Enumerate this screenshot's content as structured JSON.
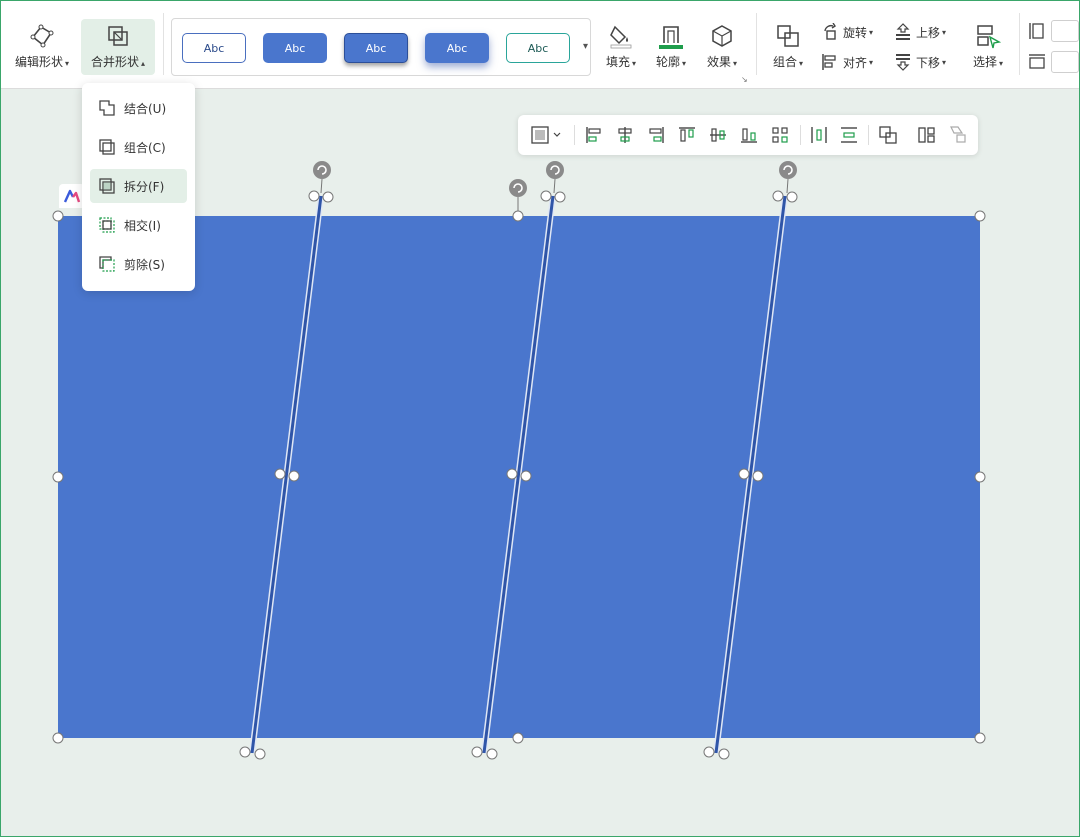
{
  "ribbon": {
    "edit_shape": "编辑形状",
    "merge_shape": "合并形状",
    "style_label": "Abc",
    "fill": "填充",
    "outline": "轮廓",
    "effect": "效果",
    "group": "组合",
    "rotate": "旋转",
    "align": "对齐",
    "bring_forward": "上移",
    "send_backward": "下移",
    "select": "选择"
  },
  "merge_menu": {
    "items": [
      {
        "label": "结合(U)",
        "icon": "union-icon"
      },
      {
        "label": "组合(C)",
        "icon": "combine-icon"
      },
      {
        "label": "拆分(F)",
        "icon": "fragment-icon"
      },
      {
        "label": "相交(I)",
        "icon": "intersect-icon"
      },
      {
        "label": "剪除(S)",
        "icon": "subtract-icon"
      }
    ],
    "highlighted": "拆分(F)"
  },
  "colors": {
    "accent": "#1e9d4b",
    "shape_fill": "#4a76cd",
    "line": "#2f55a8"
  }
}
